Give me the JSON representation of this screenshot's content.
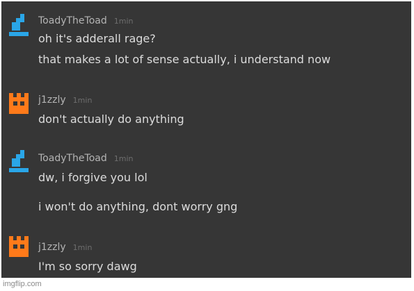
{
  "colors": {
    "background": "#363636",
    "username": "#b4b4b4",
    "timestamp": "#6e6e6e",
    "message": "#dcdcdc",
    "toady_avatar": "#2aa6e8",
    "j1zzly_avatar": "#ff7a1a"
  },
  "messages": [
    {
      "username": "ToadyTheToad",
      "time": "1min",
      "avatar_icon": "blue-toad-icon",
      "lines": [
        "oh it's adderall rage?",
        "that makes a lot of sense actually, i understand now"
      ]
    },
    {
      "username": "j1zzly",
      "time": "1min",
      "avatar_icon": "orange-crown-icon",
      "lines": [
        "don't actually do anything"
      ]
    },
    {
      "username": "ToadyTheToad",
      "time": "1min",
      "avatar_icon": "blue-toad-icon",
      "lines": [
        "dw, i forgive you lol",
        "i won't do anything, dont worry gng"
      ]
    },
    {
      "username": "j1zzly",
      "time": "1min",
      "avatar_icon": "orange-crown-icon",
      "lines": [
        "I'm so sorry dawg"
      ]
    }
  ],
  "watermark": "imgflip.com"
}
